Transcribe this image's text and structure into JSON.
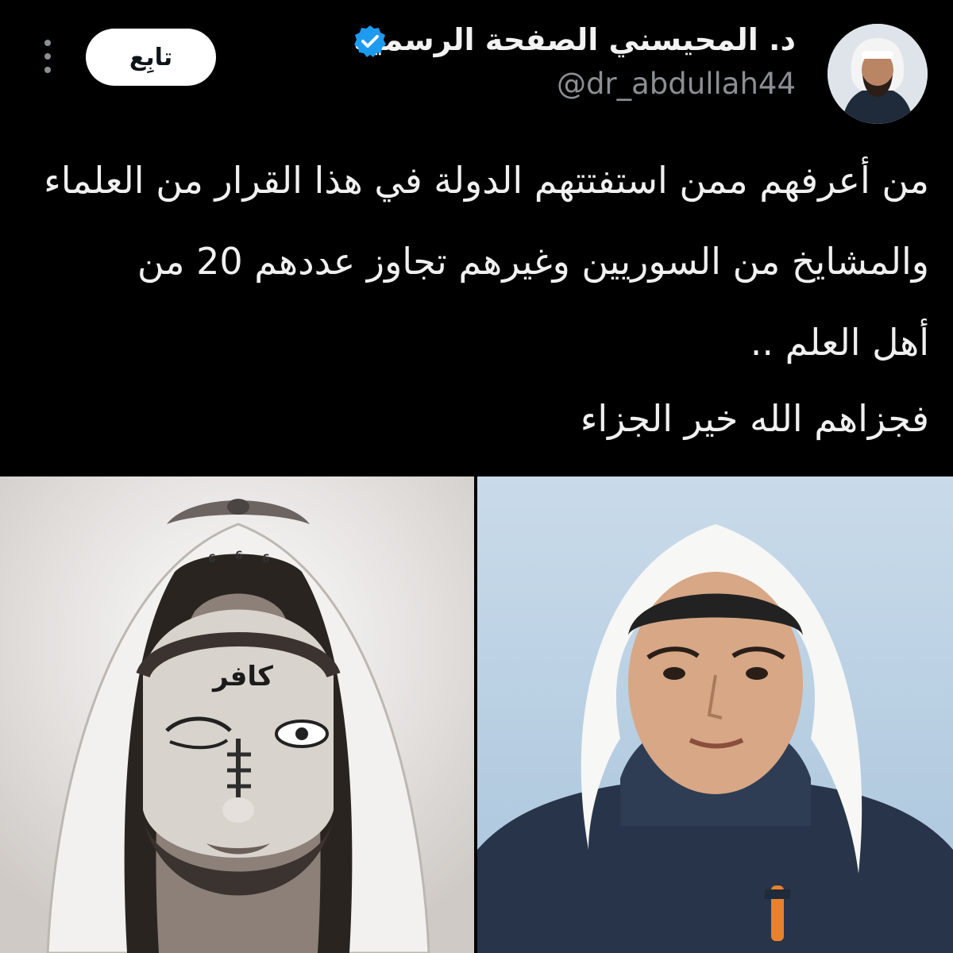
{
  "header": {
    "display_name": "د. المحيسني الصفحة الرسمية",
    "handle": "@dr_abdullah44",
    "follow_label": "تابِع",
    "verified": true,
    "icons": [
      "verified-badge-icon",
      "more-options-icon"
    ],
    "accent_color": "#1d9bf0"
  },
  "tweet": {
    "lines": [
      "من أعرفهم ممن استفتتهم الدولة في هذا القرار من العلماء",
      "والمشايخ من السوريين وغيرهم تجاوز عددهم 20 من",
      "أهل العلم ..",
      "فجزاهم الله خير الجزاء"
    ]
  },
  "media": {
    "left_image": {
      "forehead_text": "كافر",
      "marks": [
        "6",
        "6",
        "6"
      ]
    },
    "right_image": {}
  }
}
